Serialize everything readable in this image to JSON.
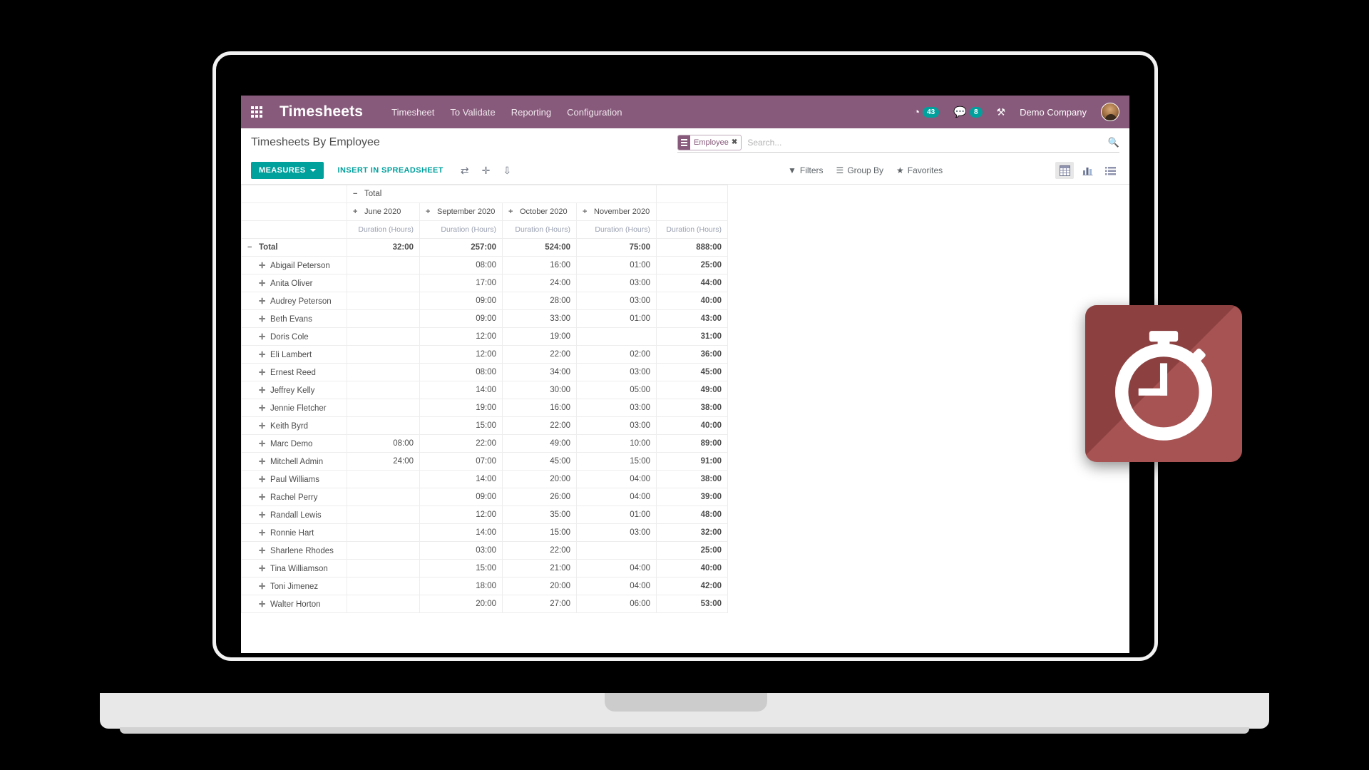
{
  "navbar": {
    "apps_icon": "apps-grid-icon",
    "brand": "Timesheets",
    "menu": [
      {
        "label": "Timesheet"
      },
      {
        "label": "To Validate"
      },
      {
        "label": "Reporting"
      },
      {
        "label": "Configuration"
      }
    ],
    "activity_icon": "clock-activity-icon",
    "activity_count": "43",
    "messages_icon": "chat-bubble-icon",
    "messages_count": "8",
    "debug_icon": "wrench-icon",
    "company": "Demo Company",
    "avatar": "user-avatar",
    "bg_color": "#875a7b"
  },
  "control_panel": {
    "title": "Timesheets By Employee",
    "search": {
      "facet_label": "Employee",
      "facet_icon": "group-by-icon",
      "facet_remove_icon": "close-icon",
      "placeholder": "Search...",
      "value": "",
      "search_icon": "search-icon"
    },
    "measures_label": "MEASURES",
    "insert_spreadsheet_label": "INSERT IN SPREADSHEET",
    "icons": [
      {
        "name": "flip-axis-icon",
        "glyph": "⇄"
      },
      {
        "name": "expand-all-icon",
        "glyph": "✛"
      },
      {
        "name": "download-xlsx-icon",
        "glyph": "⇩"
      }
    ],
    "filters_label": "Filters",
    "filters_icon": "filter-icon",
    "groupby_label": "Group By",
    "groupby_icon": "list-lines-icon",
    "favorites_label": "Favorites",
    "favorites_icon": "star-icon",
    "views": [
      {
        "name": "pivot-view-icon",
        "active": true
      },
      {
        "name": "graph-view-icon",
        "active": false
      },
      {
        "name": "list-view-icon",
        "active": false
      }
    ],
    "accent_color": "#00a09d"
  },
  "pivot": {
    "col_group_header": "Total",
    "col_group_toggle": "−",
    "column_toggle": "+",
    "columns": [
      "June 2020",
      "September 2020",
      "October 2020",
      "November 2020"
    ],
    "measure_label": "Duration (Hours)",
    "total_column_label": "",
    "row_header_toggle": "−",
    "row_header_label": "Total",
    "row_toggle": "✛",
    "total_row": {
      "label": "Total",
      "values": [
        "32:00",
        "257:00",
        "524:00",
        "75:00"
      ],
      "total": "888:00"
    },
    "rows": [
      {
        "label": "Abigail Peterson",
        "values": [
          "",
          "08:00",
          "16:00",
          "01:00"
        ],
        "total": "25:00"
      },
      {
        "label": "Anita Oliver",
        "values": [
          "",
          "17:00",
          "24:00",
          "03:00"
        ],
        "total": "44:00"
      },
      {
        "label": "Audrey Peterson",
        "values": [
          "",
          "09:00",
          "28:00",
          "03:00"
        ],
        "total": "40:00"
      },
      {
        "label": "Beth Evans",
        "values": [
          "",
          "09:00",
          "33:00",
          "01:00"
        ],
        "total": "43:00"
      },
      {
        "label": "Doris Cole",
        "values": [
          "",
          "12:00",
          "19:00",
          ""
        ],
        "total": "31:00"
      },
      {
        "label": "Eli Lambert",
        "values": [
          "",
          "12:00",
          "22:00",
          "02:00"
        ],
        "total": "36:00"
      },
      {
        "label": "Ernest Reed",
        "values": [
          "",
          "08:00",
          "34:00",
          "03:00"
        ],
        "total": "45:00"
      },
      {
        "label": "Jeffrey Kelly",
        "values": [
          "",
          "14:00",
          "30:00",
          "05:00"
        ],
        "total": "49:00"
      },
      {
        "label": "Jennie Fletcher",
        "values": [
          "",
          "19:00",
          "16:00",
          "03:00"
        ],
        "total": "38:00"
      },
      {
        "label": "Keith Byrd",
        "values": [
          "",
          "15:00",
          "22:00",
          "03:00"
        ],
        "total": "40:00"
      },
      {
        "label": "Marc Demo",
        "values": [
          "08:00",
          "22:00",
          "49:00",
          "10:00"
        ],
        "total": "89:00"
      },
      {
        "label": "Mitchell Admin",
        "values": [
          "24:00",
          "07:00",
          "45:00",
          "15:00"
        ],
        "total": "91:00"
      },
      {
        "label": "Paul Williams",
        "values": [
          "",
          "14:00",
          "20:00",
          "04:00"
        ],
        "total": "38:00"
      },
      {
        "label": "Rachel Perry",
        "values": [
          "",
          "09:00",
          "26:00",
          "04:00"
        ],
        "total": "39:00"
      },
      {
        "label": "Randall Lewis",
        "values": [
          "",
          "12:00",
          "35:00",
          "01:00"
        ],
        "total": "48:00"
      },
      {
        "label": "Ronnie Hart",
        "values": [
          "",
          "14:00",
          "15:00",
          "03:00"
        ],
        "total": "32:00"
      },
      {
        "label": "Sharlene Rhodes",
        "values": [
          "",
          "03:00",
          "22:00",
          ""
        ],
        "total": "25:00"
      },
      {
        "label": "Tina Williamson",
        "values": [
          "",
          "15:00",
          "21:00",
          "04:00"
        ],
        "total": "40:00"
      },
      {
        "label": "Toni Jimenez",
        "values": [
          "",
          "18:00",
          "20:00",
          "04:00"
        ],
        "total": "42:00"
      },
      {
        "label": "Walter Horton",
        "values": [
          "",
          "20:00",
          "27:00",
          "06:00"
        ],
        "total": "53:00"
      }
    ]
  },
  "app_badge": {
    "icon": "stopwatch-icon",
    "bg_color": "#a34a4a"
  }
}
